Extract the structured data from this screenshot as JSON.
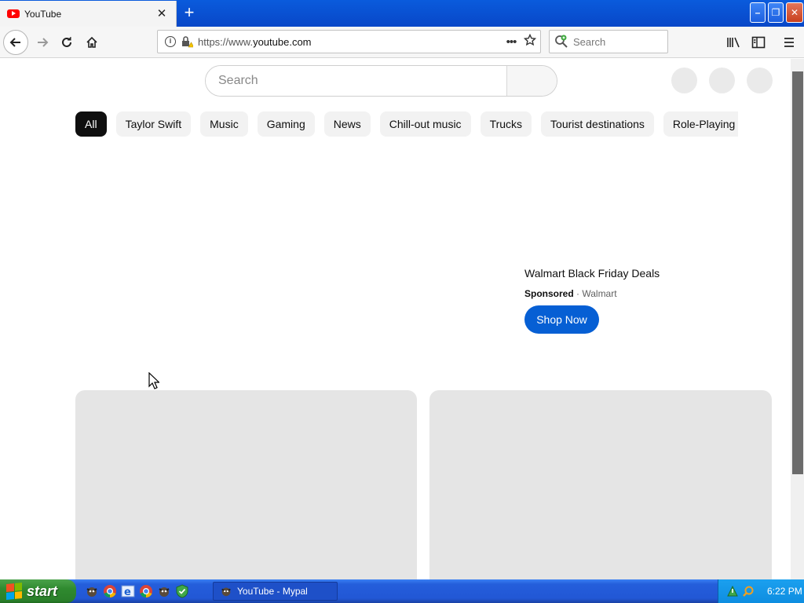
{
  "browser": {
    "tab": {
      "title": "YouTube",
      "close_label": "✕"
    },
    "new_tab_label": "+",
    "window_controls": {
      "minimize": "–",
      "maximize": "❐",
      "close": "✕"
    },
    "url": {
      "prefix": "https://www.",
      "host": "youtube.com"
    },
    "more_label": "•••",
    "web_search_placeholder": "Search"
  },
  "youtube": {
    "search_placeholder": "Search",
    "chips": [
      {
        "label": "All",
        "active": true
      },
      {
        "label": "Taylor Swift"
      },
      {
        "label": "Music"
      },
      {
        "label": "Gaming"
      },
      {
        "label": "News"
      },
      {
        "label": "Chill-out music"
      },
      {
        "label": "Trucks"
      },
      {
        "label": "Tourist destinations"
      },
      {
        "label": "Role-Playing"
      }
    ],
    "ad": {
      "title": "Walmart Black Friday Deals",
      "sponsored": "Sponsored",
      "separator": " · ",
      "advertiser": "Walmart",
      "cta": "Shop Now"
    }
  },
  "taskbar": {
    "start_label": "start",
    "task_label": "YouTube - Mypal",
    "clock": "6:22 PM"
  },
  "colors": {
    "titlebar": "#0a5bdc",
    "chip_active": "#0f0f0f",
    "cta": "#065fd4",
    "youtube_red": "#ff0000",
    "taskbar": "#245edb",
    "start_green": "#2f8a2f"
  },
  "icons": {
    "tab_favicon": "youtube-logo-icon",
    "back": "back-arrow-icon",
    "forward": "forward-arrow-icon",
    "reload": "reload-icon",
    "home": "home-icon",
    "info": "info-icon",
    "lock": "lock-warning-icon",
    "bookmark": "star-icon",
    "search_engine": "search-engine-icon",
    "library": "library-icon",
    "sidebar": "sidebar-icon",
    "menu": "hamburger-menu-icon"
  }
}
